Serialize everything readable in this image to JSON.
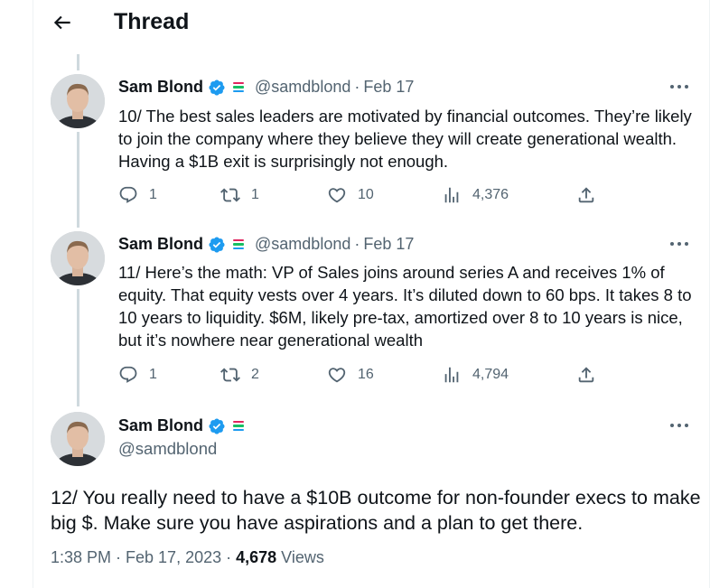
{
  "header": {
    "title": "Thread"
  },
  "colors": {
    "accent": "#1d9bf0",
    "muted": "#536471",
    "text": "#0f1419",
    "line": "#cfd9de"
  },
  "tweets": [
    {
      "name": "Sam Blond",
      "handle": "@samdblond",
      "date": "Feb 17",
      "text": "10/ The best sales leaders are motivated by financial outcomes. They’re likely to join the company where they believe they will create generational wealth. Having a $1B exit is surprisingly not enough.",
      "replies": "1",
      "retweets": "1",
      "likes": "10",
      "views": "4,376"
    },
    {
      "name": "Sam Blond",
      "handle": "@samdblond",
      "date": "Feb 17",
      "text": "11/ Here’s the math: VP of Sales joins around series A and receives 1% of equity. That equity vests over 4 years. It’s diluted down to 60 bps. It takes 8 to 10 years to liquidity. $6M, likely pre-tax, amortized over 8 to 10 years is nice, but it’s nowhere near generational wealth",
      "replies": "1",
      "retweets": "2",
      "likes": "16",
      "views": "4,794"
    }
  ],
  "main_tweet": {
    "name": "Sam Blond",
    "handle": "@samdblond",
    "text": "12/ You really need to have a $10B outcome for non-founder execs to make big $. Make sure you have aspirations and a plan to get there.",
    "timestamp": "1:38 PM · Feb 17, 2023 · ",
    "views_count": "4,678",
    "views_label": " Views"
  },
  "icons": [
    "back-arrow-icon",
    "verified-badge-icon",
    "flag-icon",
    "more-icon",
    "reply-icon",
    "retweet-icon",
    "like-icon",
    "views-icon",
    "share-icon",
    "avatar"
  ]
}
